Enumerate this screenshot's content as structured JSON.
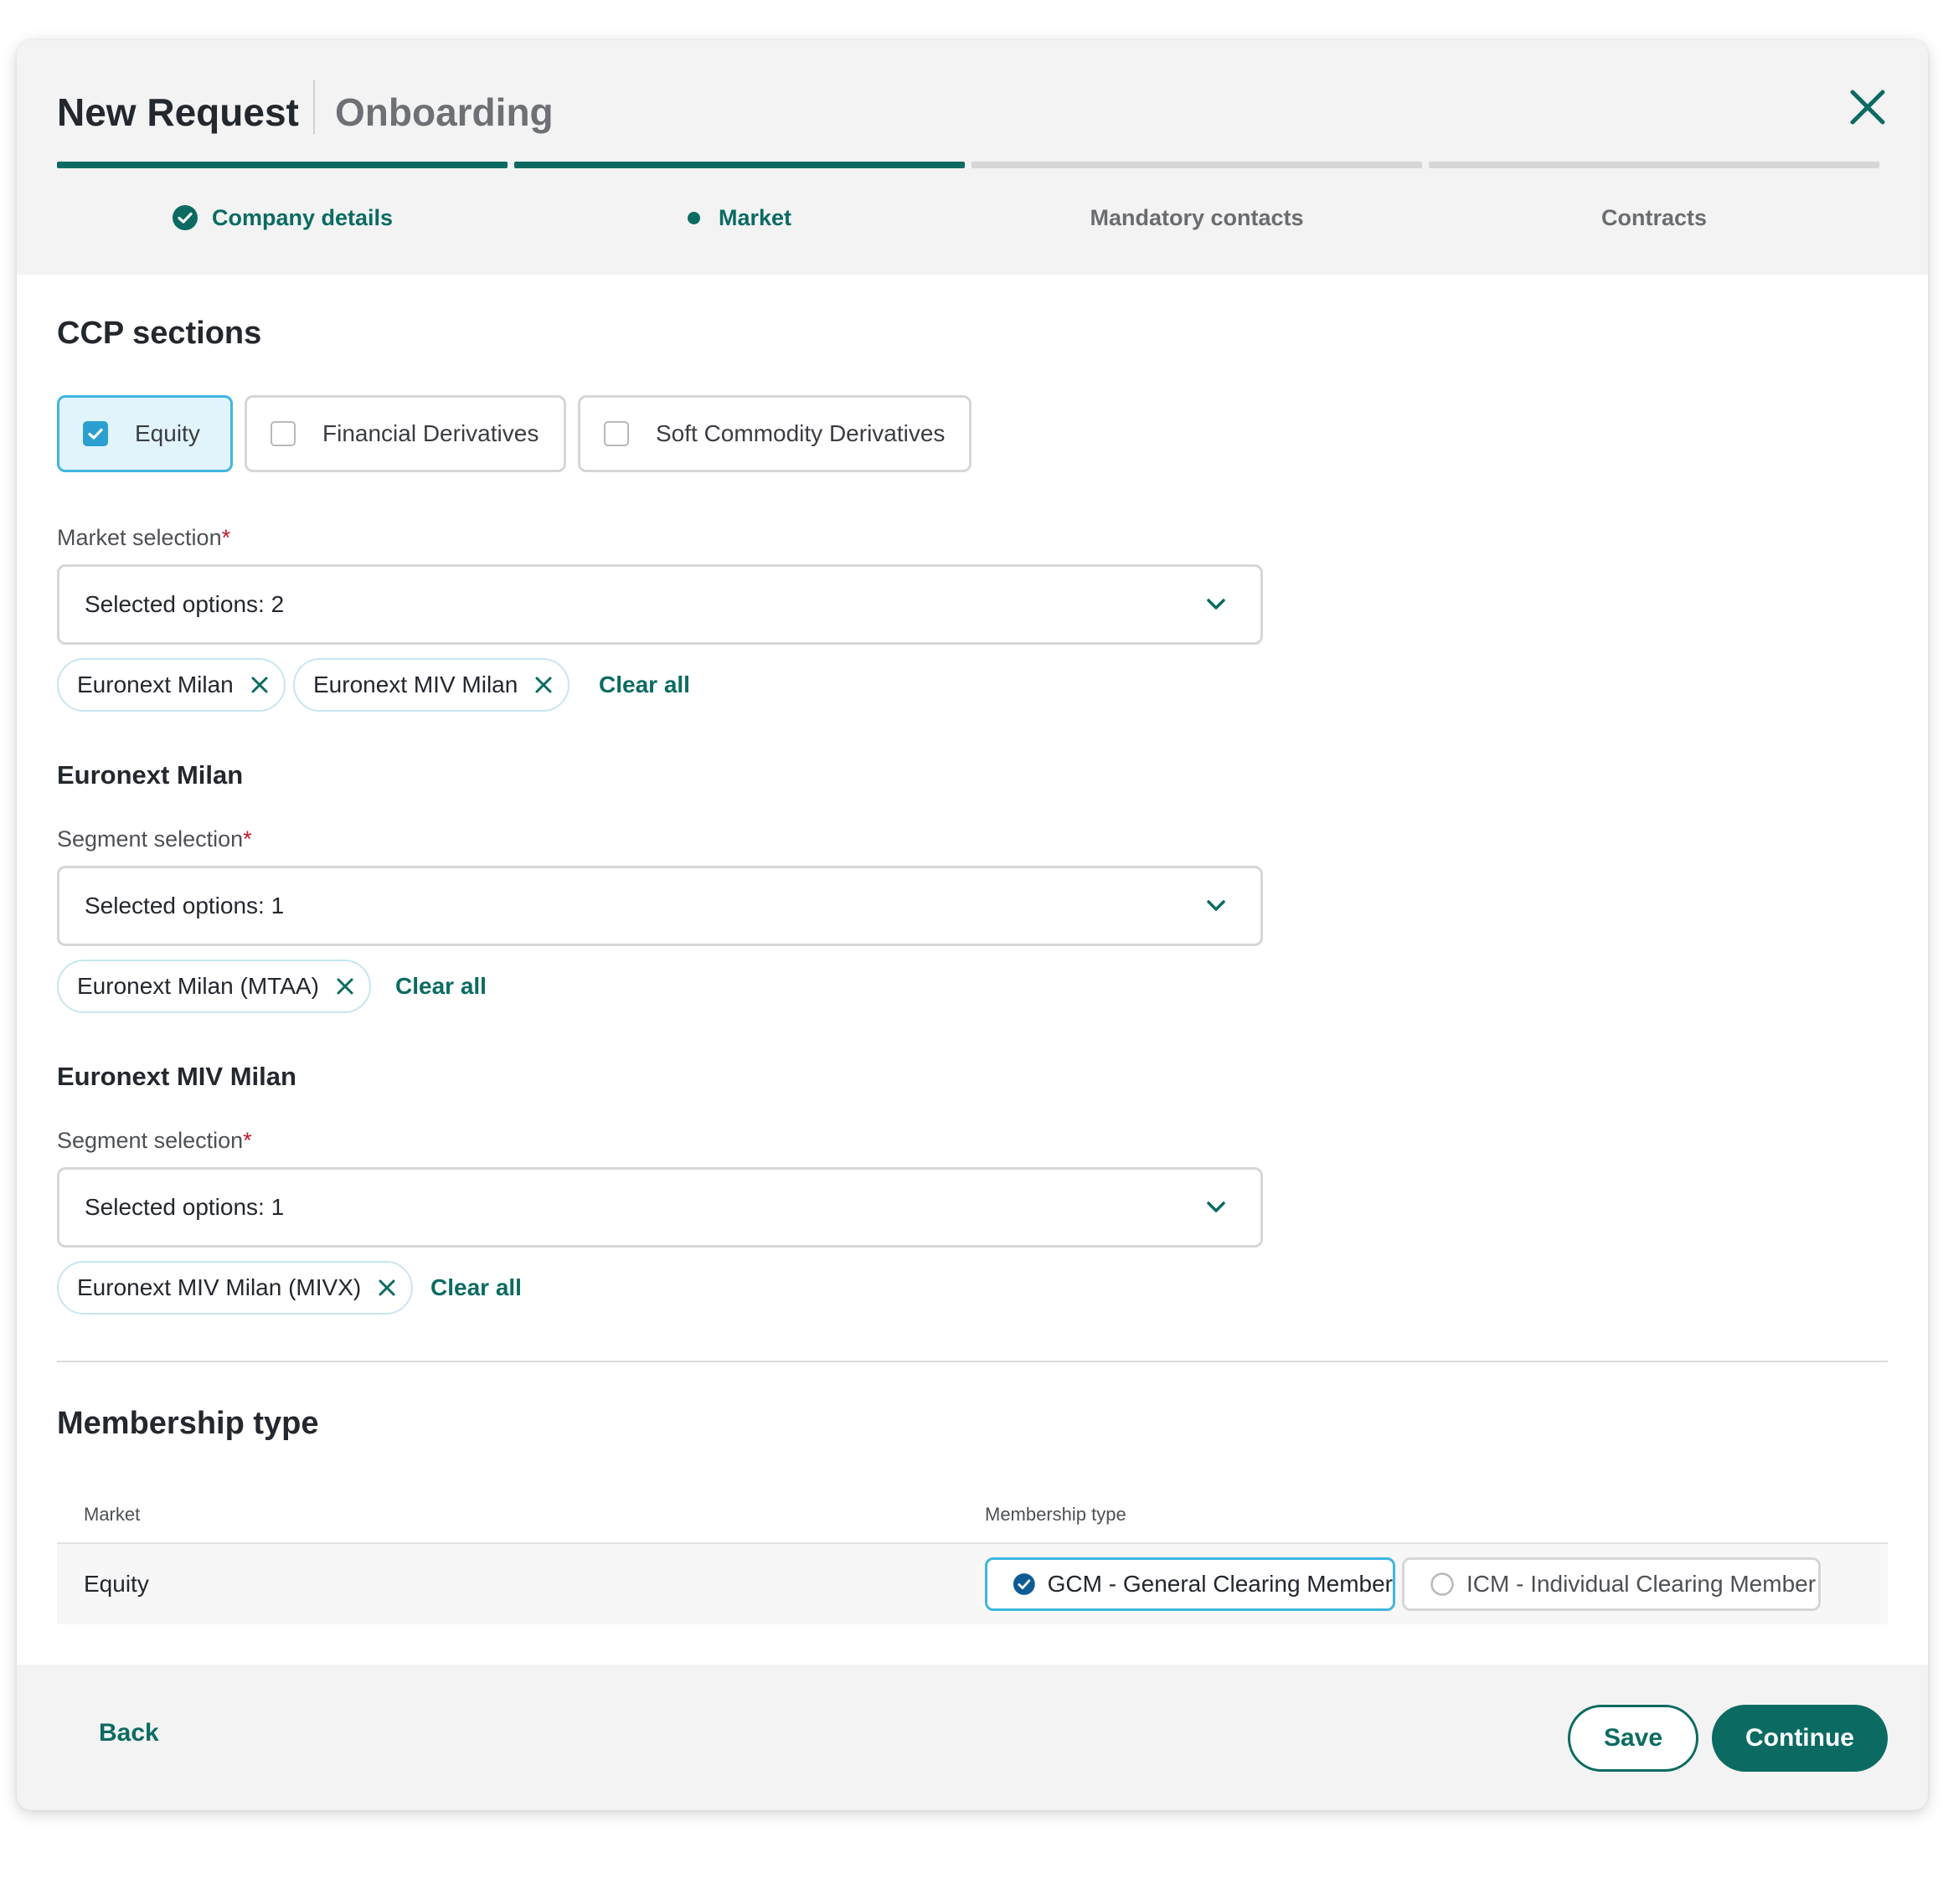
{
  "header": {
    "title": "New Request",
    "subtitle": "Onboarding",
    "close_icon": "close-icon"
  },
  "steps": [
    {
      "label": "Company details",
      "status": "completed",
      "icon": "check-circle-icon"
    },
    {
      "label": "Market",
      "status": "current",
      "icon": "dot-icon"
    },
    {
      "label": "Mandatory contacts",
      "status": "upcoming"
    },
    {
      "label": "Contracts",
      "status": "upcoming"
    }
  ],
  "ccp": {
    "title": "CCP sections",
    "options": [
      {
        "label": "Equity",
        "checked": true
      },
      {
        "label": "Financial Derivatives",
        "checked": false
      },
      {
        "label": "Soft Commodity Derivatives",
        "checked": false
      }
    ]
  },
  "market_selection": {
    "label": "Market selection",
    "required_mark": "*",
    "value": "Selected options: 2",
    "chips": [
      "Euronext Milan",
      "Euronext MIV Milan"
    ],
    "clear_label": "Clear all"
  },
  "segments": [
    {
      "title": "Euronext Milan",
      "label": "Segment selection",
      "required_mark": "*",
      "value": "Selected options: 1",
      "chips": [
        "Euronext Milan (MTAA)"
      ],
      "clear_label": "Clear all"
    },
    {
      "title": "Euronext MIV Milan",
      "label": "Segment selection",
      "required_mark": "*",
      "value": "Selected options: 1",
      "chips": [
        "Euronext MIV Milan (MIVX)"
      ],
      "clear_label": "Clear all"
    }
  ],
  "membership": {
    "title": "Membership type",
    "columns": [
      "Market",
      "Membership type"
    ],
    "rows": [
      {
        "market": "Equity",
        "options": [
          {
            "label": "GCM - General Clearing Member",
            "selected": true
          },
          {
            "label": "ICM - Individual Clearing Member",
            "selected": false
          }
        ]
      }
    ]
  },
  "footer": {
    "back_label": "Back",
    "save_label": "Save",
    "continue_label": "Continue"
  },
  "colors": {
    "primary": "#0b6b62",
    "accent": "#2b9fd0",
    "required": "#c0192c",
    "header_bg": "#f3f3f3"
  }
}
